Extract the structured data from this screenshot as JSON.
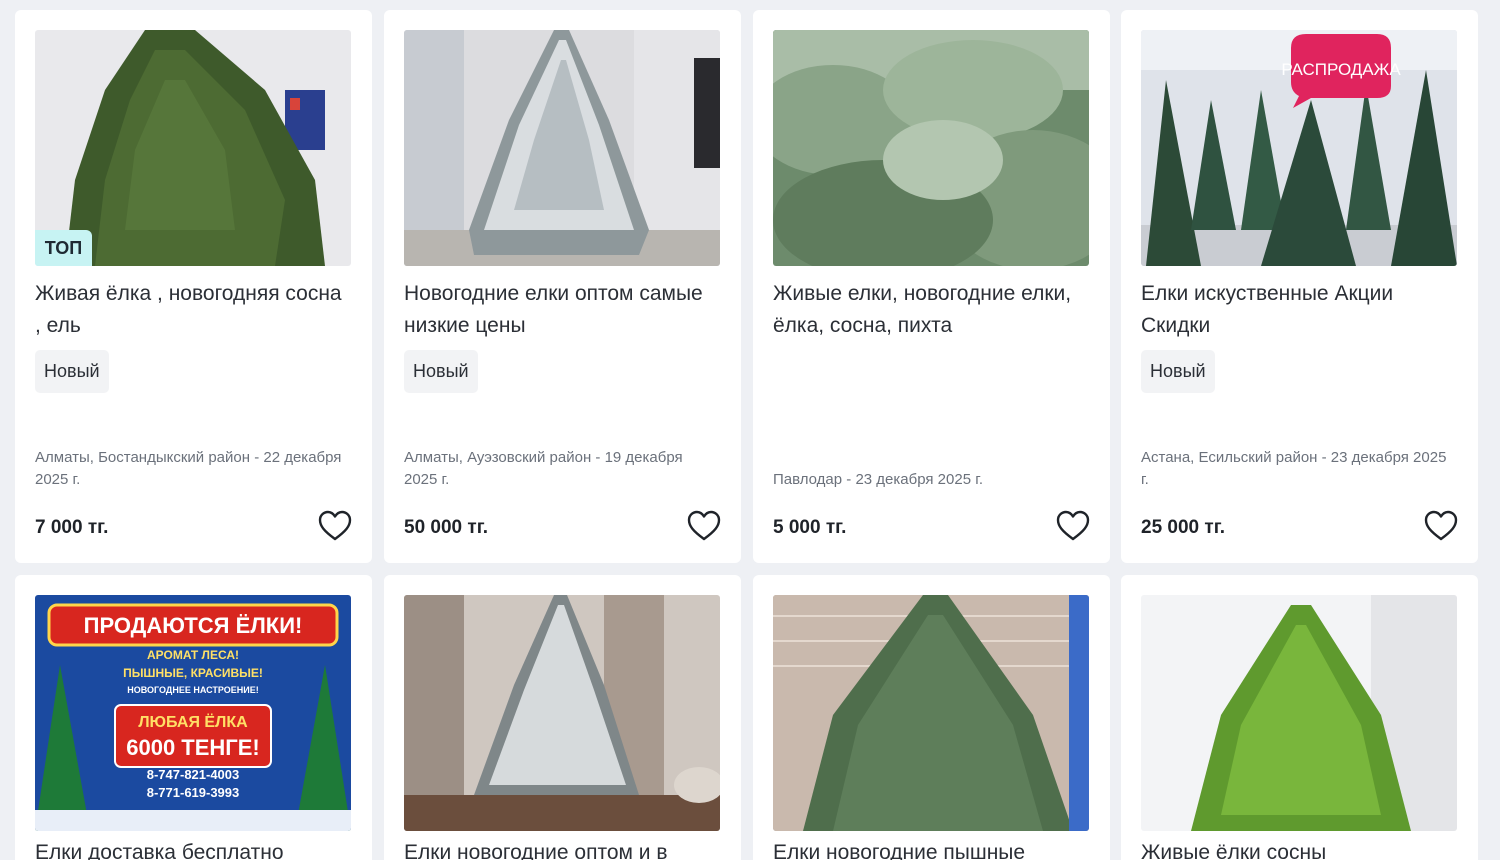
{
  "listings": [
    {
      "title": "Живая ёлка , новогодняя сосна , ель",
      "badge": "ТОП",
      "condition": "Новый",
      "location": "Алматы, Бостандыкский район - 22 декабря 2025 г.",
      "price": "7 000 тг."
    },
    {
      "title": "Новогодние елки оптом самые низкие цены",
      "condition": "Новый",
      "location": "Алматы, Ауэзовский район - 19 декабря 2025 г.",
      "price": "50 000 тг."
    },
    {
      "title": "Живые елки, новогодние елки, ёлка, сосна, пихта",
      "location": "Павлодар - 23 декабря 2025 г.",
      "price": "5 000 тг."
    },
    {
      "title": "Елки искуственные Акции Скидки",
      "condition": "Новый",
      "location": "Астана, Есильский район - 23 декабря 2025 г.",
      "price": "25 000 тг.",
      "photo_sticker": "РАСПРОДАЖА"
    },
    {
      "title": "Елки доставка бесплатно",
      "photo_texts": [
        "ПРОДАЮТСЯ ЁЛКИ!",
        "АРОМАТ ЛЕСА!",
        "ПЫШНЫЕ, КРАСИВЫЕ!",
        "НОВОГОДНЕЕ НАСТРОЕНИЕ!",
        "ЛЮБАЯ ЁЛКА",
        "6000 ТЕНГЕ!",
        "8-747-821-4003",
        "8-771-619-3993"
      ]
    },
    {
      "title": "Елки новогодние оптом и в"
    },
    {
      "title": "Елки новогодние пышные"
    },
    {
      "title": "Живые ёлки сосны"
    }
  ],
  "icons": {
    "favorite": "heart-outline-icon"
  }
}
